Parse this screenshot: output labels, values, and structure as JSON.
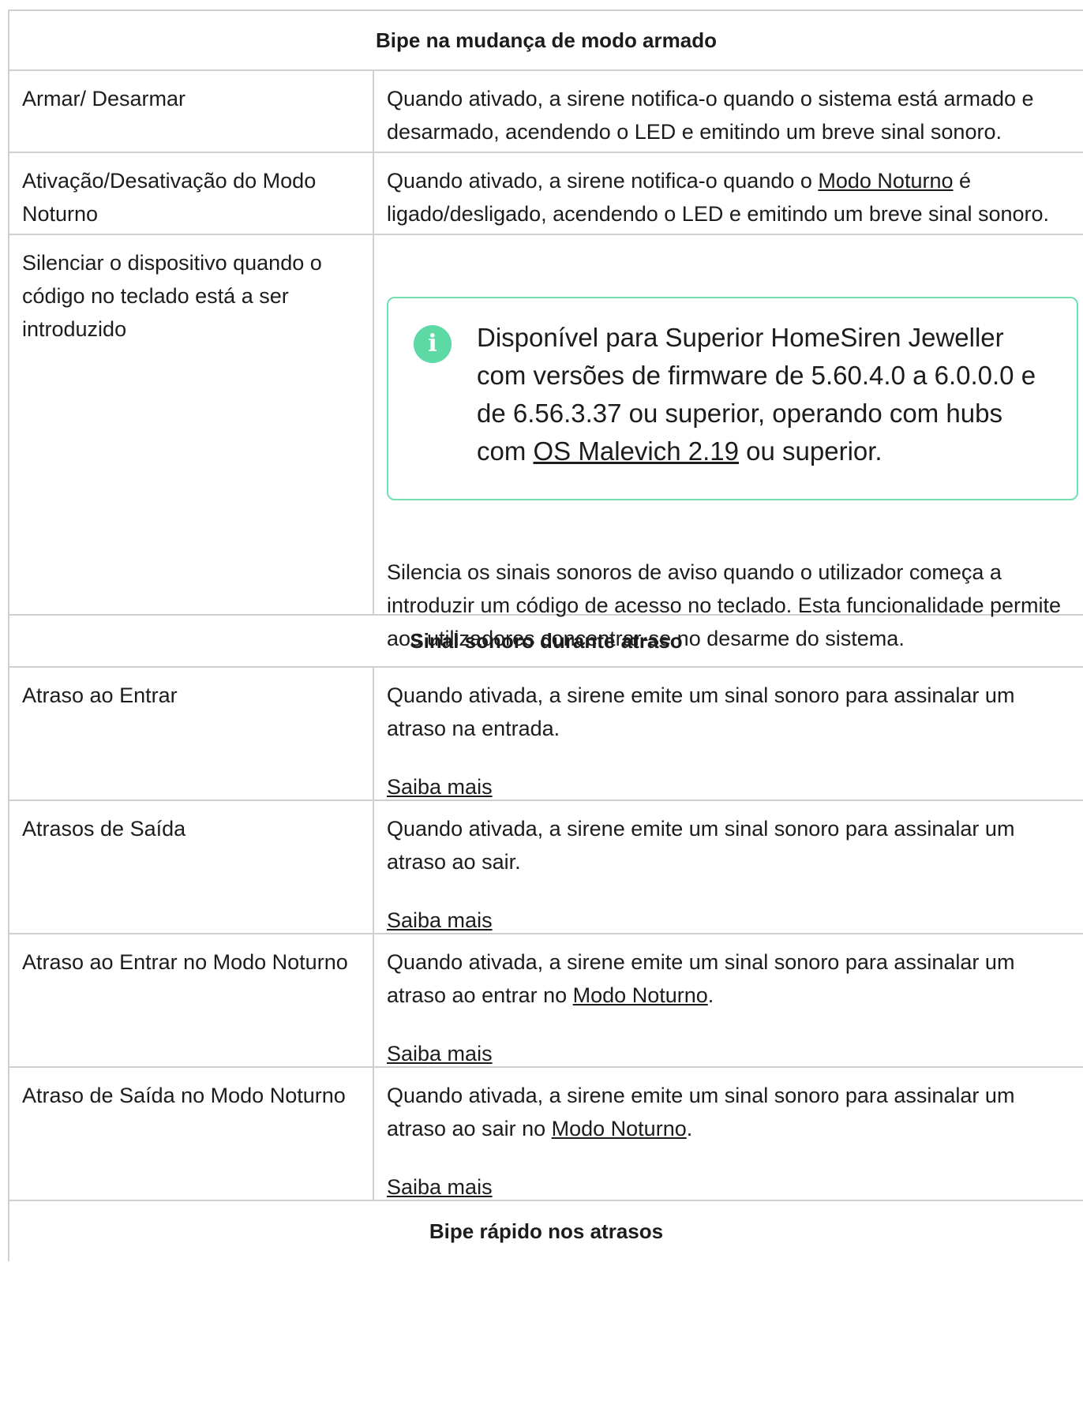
{
  "sections": {
    "s1_title": "Bipe na mudança de modo armado",
    "s2_title": "Sinal sonoro durante atraso",
    "s3_title": "Bipe rápido nos atrasos"
  },
  "rows": {
    "arm": {
      "label": "Armar/ Desarmar",
      "text": "Quando ativado, a sirene notifica-o quando o sistema está armado e desarmado, acendendo o LED e emitindo um breve sinal sonoro."
    },
    "night": {
      "label": "Ativação/Desativação do Modo Noturno",
      "text_a": "Quando ativado, a sirene notifica-o quando o ",
      "link": "Modo Noturno",
      "text_b": " é ligado/desligado, acendendo o LED e emitindo um breve sinal sonoro."
    },
    "mute": {
      "label": "Silenciar o dispositivo quando o código no teclado está a ser introduzido",
      "note_icon": "info-icon",
      "note_a": "Disponível para Superior HomeSiren Jeweller com versões de firmware de 5.60.4.0 a 6.0.0.0 e de 6.56.3.37 ou superior, operando com hubs com ",
      "note_link": "OS Malevich 2.19",
      "note_b": " ou superior.",
      "text": "Silencia os sinais sonoros de aviso quando o utilizador começa a introduzir um código de acesso no teclado. Esta funcionalidade permite aos utilizadores concentrar-se no desarme do sistema."
    },
    "entry": {
      "label": "Atraso ao Entrar",
      "text": "Quando ativada, a sirene emite um sinal sonoro para assinalar um atraso na entrada.",
      "more": "Saiba mais"
    },
    "exit": {
      "label": "Atrasos de Saída",
      "text": "Quando ativada, a sirene emite um sinal sonoro para assinalar um atraso ao sair.",
      "more": "Saiba mais"
    },
    "entry_night": {
      "label": "Atraso ao Entrar no Modo Noturno",
      "text_a": "Quando ativada, a sirene emite um sinal sonoro para assinalar um atraso ao entrar no ",
      "link": "Modo Noturno",
      "text_b": ".",
      "more": "Saiba mais"
    },
    "exit_night": {
      "label": "Atraso de Saída no Modo Noturno",
      "text_a": "Quando ativada, a sirene emite um sinal sonoro para assinalar um atraso ao sair no ",
      "link": "Modo Noturno",
      "text_b": ".",
      "more": "Saiba mais"
    }
  },
  "colors": {
    "border": "#cfcfcf",
    "note_border": "#6fe0b2",
    "note_icon_bg": "#5cd9a5"
  }
}
